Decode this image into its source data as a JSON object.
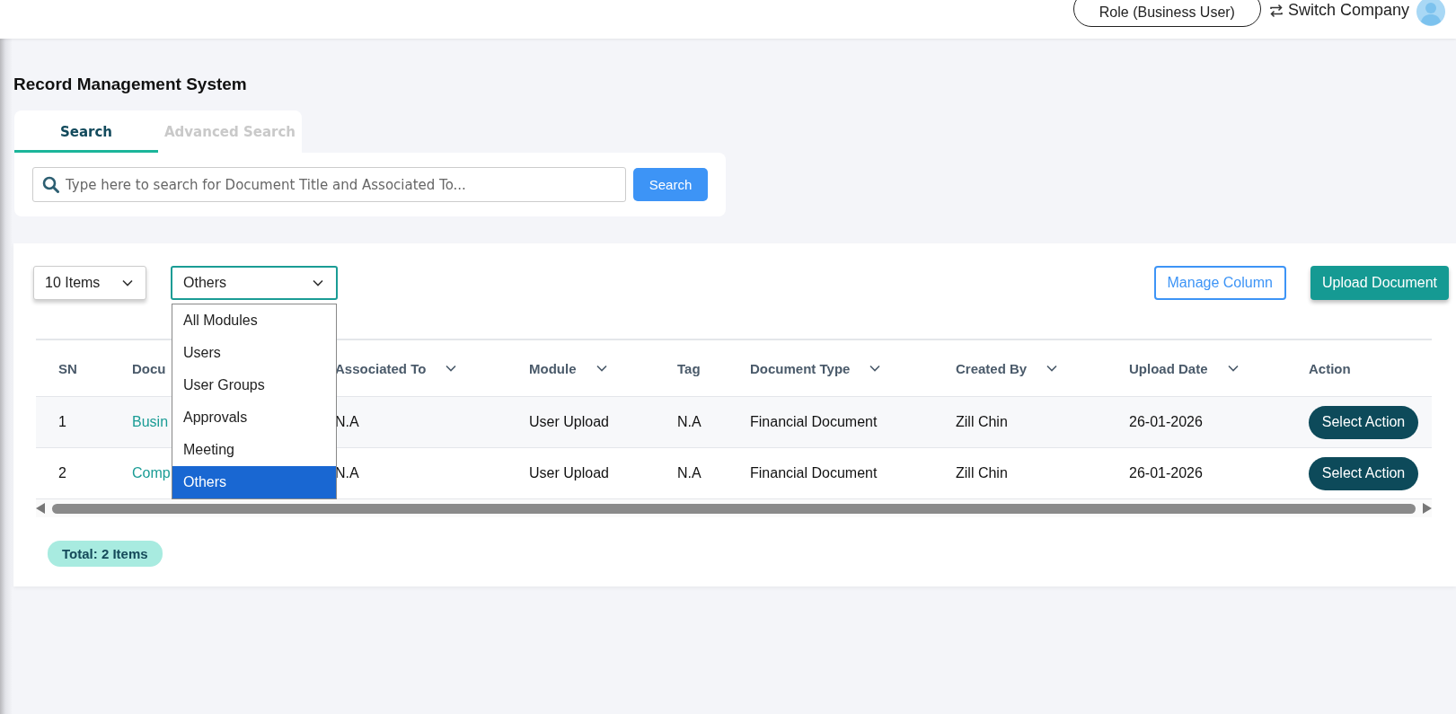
{
  "top_bar": {
    "role_button": "Role (Business User)",
    "switch_company": "Switch Company"
  },
  "page_title": "Record Management System",
  "tabs": [
    {
      "label": "Search",
      "selected": true
    },
    {
      "label": "Advanced Search",
      "selected": false
    }
  ],
  "search": {
    "placeholder": "Type here to search for Document Title and Associated To...",
    "button": "Search"
  },
  "toolbar": {
    "page_size": "10 Items",
    "module_filter": {
      "value": "Others",
      "expanded": true,
      "options": [
        {
          "label": "All Modules",
          "selected": false
        },
        {
          "label": "Users",
          "selected": false
        },
        {
          "label": "User Groups",
          "selected": false
        },
        {
          "label": "Approvals",
          "selected": false
        },
        {
          "label": "Meeting",
          "selected": false
        },
        {
          "label": "Others",
          "selected": true
        }
      ]
    },
    "buttons": [
      {
        "label": "Manage Column",
        "kind": "outline"
      },
      {
        "label": "Upload Document",
        "kind": "primary"
      }
    ]
  },
  "table": {
    "columns": [
      {
        "label": "SN",
        "sortable": false,
        "kind": "text"
      },
      {
        "label": "Docu",
        "sortable": false,
        "kind": "link"
      },
      {
        "label": "Associated To",
        "sortable": true,
        "kind": "text"
      },
      {
        "label": "Module",
        "sortable": true,
        "kind": "text"
      },
      {
        "label": "Tag",
        "sortable": false,
        "kind": "text"
      },
      {
        "label": "Document Type",
        "sortable": true,
        "kind": "text"
      },
      {
        "label": "Created By",
        "sortable": true,
        "kind": "text"
      },
      {
        "label": "Upload Date",
        "sortable": true,
        "kind": "text"
      },
      {
        "label": "Action",
        "sortable": false,
        "kind": "action"
      }
    ],
    "rows": [
      {
        "cells": [
          "1",
          "Busin",
          "N.A",
          "User Upload",
          "N.A",
          "Financial Document",
          "Zill Chin",
          "26-01-2026",
          "Select Action"
        ]
      },
      {
        "cells": [
          "2",
          "Comp",
          "N.A",
          "User Upload",
          "N.A",
          "Financial Document",
          "Zill Chin",
          "26-01-2026",
          "Select Action"
        ]
      }
    ]
  },
  "total": "Total: 2 Items"
}
